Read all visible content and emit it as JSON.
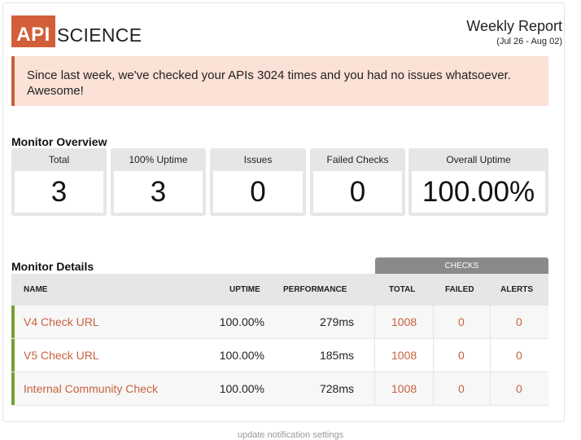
{
  "logo": {
    "mark": "API",
    "word": "SCIENCE"
  },
  "report": {
    "title": "Weekly Report",
    "range": "(Jul 26 - Aug 02)"
  },
  "alert": {
    "message": "Since last week, we've checked your APIs 3024 times and you had no issues whatsoever. Awesome!"
  },
  "overview": {
    "title": "Monitor Overview",
    "stats": [
      {
        "label": "Total",
        "value": "3"
      },
      {
        "label": "100% Uptime",
        "value": "3"
      },
      {
        "label": "Issues",
        "value": "0"
      },
      {
        "label": "Failed Checks",
        "value": "0"
      },
      {
        "label": "Overall Uptime",
        "value": "100.00%"
      }
    ]
  },
  "details": {
    "title": "Monitor Details",
    "checks_group": "CHECKS",
    "columns": {
      "name": "NAME",
      "uptime": "UPTIME",
      "performance": "PERFORMANCE",
      "total": "TOTAL",
      "failed": "FAILED",
      "alerts": "ALERTS"
    },
    "rows": [
      {
        "name": "V4 Check URL",
        "uptime": "100.00%",
        "performance": "279ms",
        "total": "1008",
        "failed": "0",
        "alerts": "0"
      },
      {
        "name": "V5 Check URL",
        "uptime": "100.00%",
        "performance": "185ms",
        "total": "1008",
        "failed": "0",
        "alerts": "0"
      },
      {
        "name": "Internal Community Check",
        "uptime": "100.00%",
        "performance": "728ms",
        "total": "1008",
        "failed": "0",
        "alerts": "0"
      }
    ]
  },
  "footer": {
    "settings_link": "update notification settings"
  },
  "colors": {
    "brand": "#d35f3a",
    "link": "#c8613e",
    "ok_bar": "#73a232",
    "alert_bg": "#fbe1d6"
  }
}
